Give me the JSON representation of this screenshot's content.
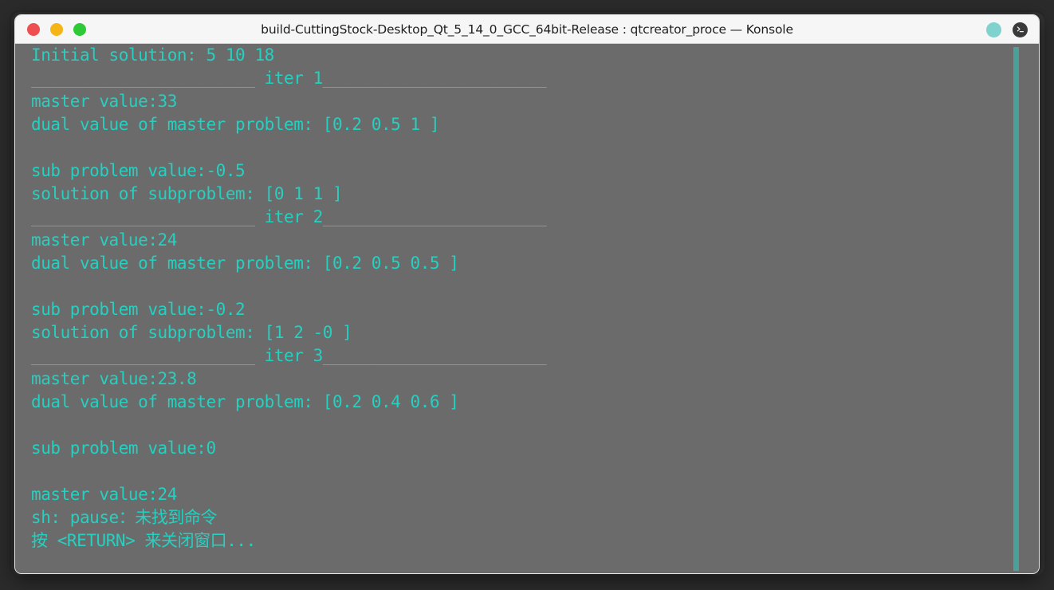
{
  "window": {
    "title": "build-CuttingStock-Desktop_Qt_5_14_0_GCC_64bit-Release : qtcreator_proce — Konsole",
    "close_label": "Close",
    "minimize_label": "Minimize",
    "maximize_label": "Maximize",
    "colors": {
      "close": "#ee4f50",
      "minimize": "#f5b516",
      "maximize": "#2dc937",
      "titlebar_bg": "#f6f6f6",
      "terminal_bg": "#6b6b6b",
      "terminal_fg": "#26d0c0",
      "scrollbar_thumb": "#4ba19a",
      "session_icon": "#7fd2ce"
    },
    "icons": {
      "session": "session-indicator-icon",
      "terminal": "terminal-prompt-icon"
    }
  },
  "terminal": {
    "lines": [
      "Initial solution: 5 10 18",
      "_______________________ iter 1_______________________",
      "master value:33",
      "dual value of master problem: [0.2 0.5 1 ]",
      "",
      "sub problem value:-0.5",
      "solution of subproblem: [0 1 1 ]",
      "_______________________ iter 2_______________________",
      "master value:24",
      "dual value of master problem: [0.2 0.5 0.5 ]",
      "",
      "sub problem value:-0.2",
      "solution of subproblem: [1 2 -0 ]",
      "_______________________ iter 3_______________________",
      "master value:23.8",
      "dual value of master problem: [0.2 0.4 0.6 ]",
      "",
      "sub problem value:0",
      "",
      "master value:24",
      "sh: pause：未找到命令",
      "按 <RETURN> 来关闭窗口...",
      ""
    ]
  }
}
